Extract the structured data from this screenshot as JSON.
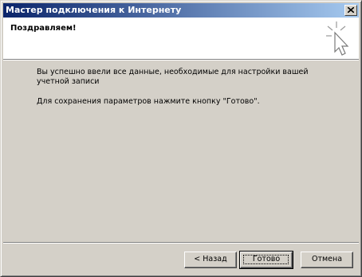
{
  "window": {
    "title": "Мастер подключения к Интернету"
  },
  "header": {
    "title": "Поздравляем!",
    "icon": "wizard-cursor-icon"
  },
  "body": {
    "line1": "Вы успешно ввели все данные, необходимые для настройки вашей учетной записи",
    "line2": "Для сохранения параметров нажмите кнопку \"Готово\"."
  },
  "buttons": {
    "back": "< Назад",
    "finish": "Готово",
    "cancel": "Отмена"
  },
  "colors": {
    "titlebar_start": "#0a246a",
    "titlebar_end": "#a6caf0",
    "face": "#d4d0c8"
  }
}
